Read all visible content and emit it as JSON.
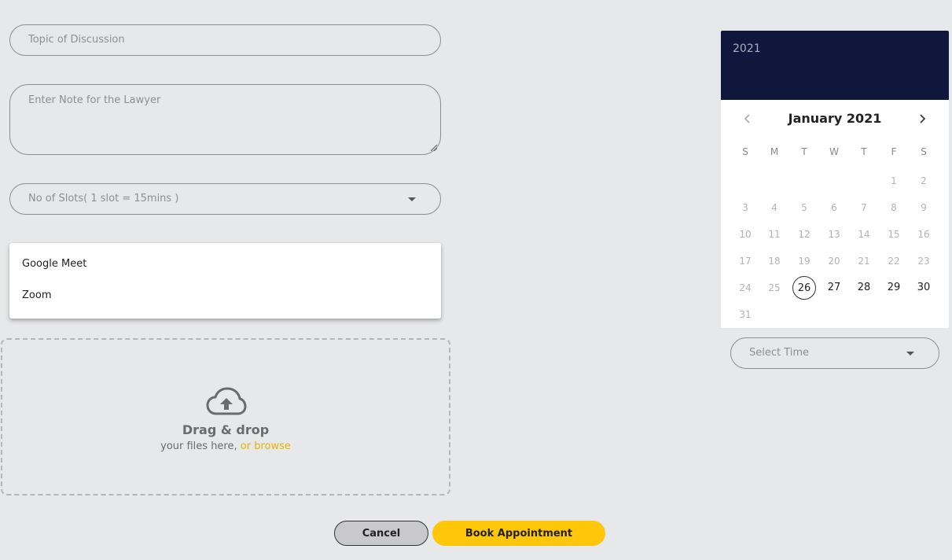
{
  "form": {
    "topic_placeholder": "Topic of Discussion",
    "note_placeholder": "Enter Note for the Lawyer",
    "slots_placeholder": "No of Slots( 1 slot = 15mins )",
    "meeting_options": [
      "Google Meet",
      "Zoom"
    ]
  },
  "upload": {
    "title": "Drag & drop",
    "subtitle": "your files here, ",
    "browse_link": "or browse",
    "icon": "cloud-upload-icon"
  },
  "actions": {
    "cancel_label": "Cancel",
    "book_label": "Book Appointment"
  },
  "calendar": {
    "year": "2021",
    "month_label": "January 2021",
    "weekdays": [
      "S",
      "M",
      "T",
      "W",
      "T",
      "F",
      "S"
    ],
    "first_weekday_index": 5,
    "days_in_month": 31,
    "selected_day": 26,
    "selectable_days": [
      26,
      27,
      28,
      29,
      30
    ],
    "header_color": "#0f173c"
  },
  "time": {
    "placeholder": "Select Time"
  },
  "colors": {
    "accent": "#ffc60a",
    "browse_link": "#e4b400",
    "background": "#e7e8ea"
  }
}
